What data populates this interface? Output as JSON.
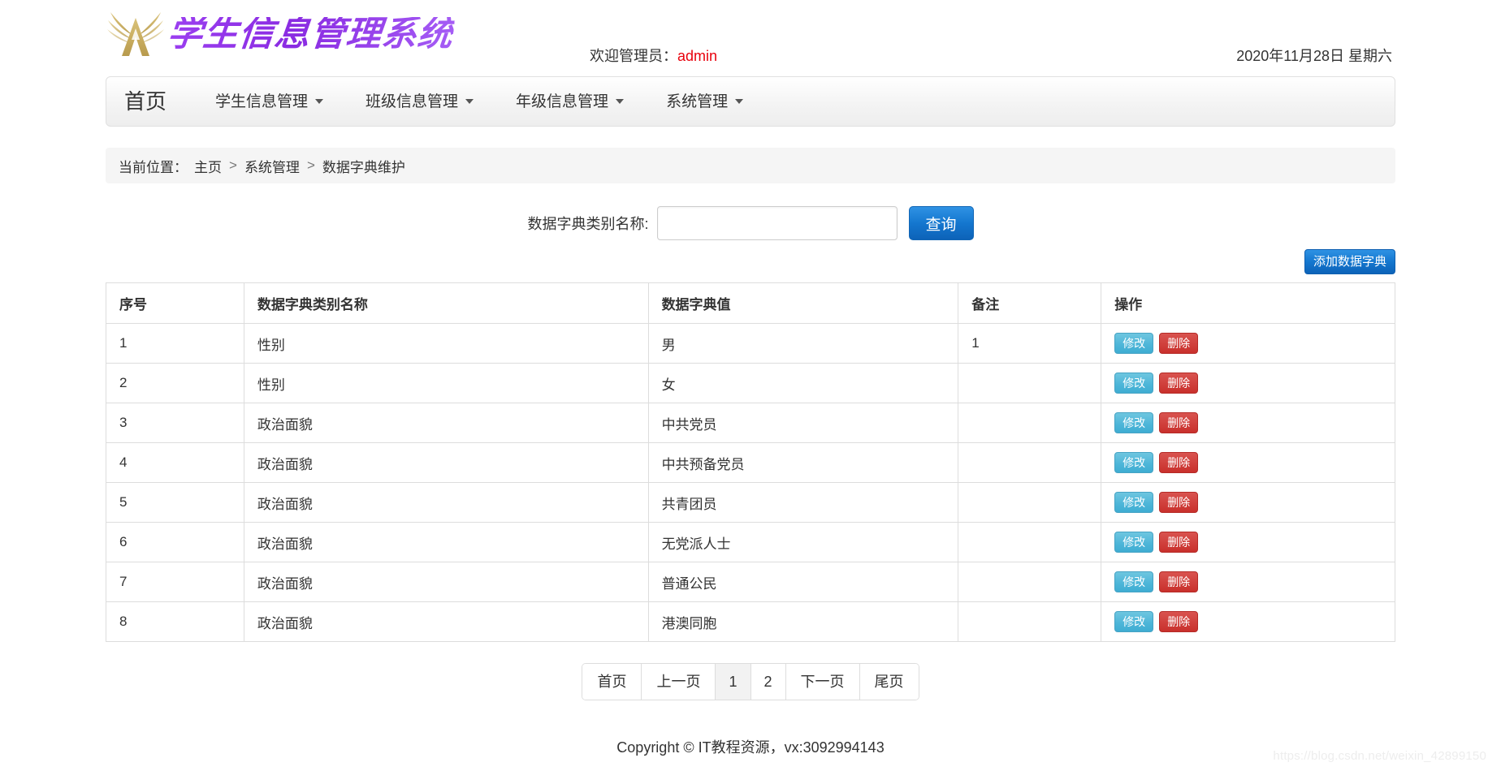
{
  "header": {
    "logo_text": "学生信息管理系统",
    "logo_icon": "winged-mountain-emblem",
    "welcome_prefix": "欢迎管理员：",
    "username": "admin",
    "date": "2020年11月28日 星期六",
    "brand_color": "#8a2be2",
    "user_color": "#e8000c"
  },
  "nav": {
    "home": "首页",
    "items": [
      {
        "label": "学生信息管理",
        "caret": "chevron-down-icon"
      },
      {
        "label": "班级信息管理",
        "caret": "chevron-down-icon"
      },
      {
        "label": "年级信息管理",
        "caret": "chevron-down-icon"
      },
      {
        "label": "系统管理",
        "caret": "chevron-down-icon"
      }
    ]
  },
  "breadcrumb": {
    "label": "当前位置：",
    "items": [
      "主页",
      "系统管理",
      "数据字典维护"
    ],
    "separator": ">"
  },
  "search": {
    "label": "数据字典类别名称:",
    "value": "",
    "placeholder": "",
    "button": "查询"
  },
  "toolbar": {
    "add_label": "添加数据字典"
  },
  "table": {
    "columns": [
      "序号",
      "数据字典类别名称",
      "数据字典值",
      "备注",
      "操作"
    ],
    "rows": [
      {
        "idx": "1",
        "name": "性别",
        "value": "男",
        "memo": "1",
        "edit": "修改",
        "del": "删除"
      },
      {
        "idx": "2",
        "name": "性别",
        "value": "女",
        "memo": "",
        "edit": "修改",
        "del": "删除"
      },
      {
        "idx": "3",
        "name": "政治面貌",
        "value": "中共党员",
        "memo": "",
        "edit": "修改",
        "del": "删除"
      },
      {
        "idx": "4",
        "name": "政治面貌",
        "value": "中共预备党员",
        "memo": "",
        "edit": "修改",
        "del": "删除"
      },
      {
        "idx": "5",
        "name": "政治面貌",
        "value": "共青团员",
        "memo": "",
        "edit": "修改",
        "del": "删除"
      },
      {
        "idx": "6",
        "name": "政治面貌",
        "value": "无党派人士",
        "memo": "",
        "edit": "修改",
        "del": "删除"
      },
      {
        "idx": "7",
        "name": "政治面貌",
        "value": "普通公民",
        "memo": "",
        "edit": "修改",
        "del": "删除"
      },
      {
        "idx": "8",
        "name": "政治面貌",
        "value": "港澳同胞",
        "memo": "",
        "edit": "修改",
        "del": "删除"
      }
    ]
  },
  "pagination": {
    "first": "首页",
    "prev": "上一页",
    "pages": [
      "1",
      "2"
    ],
    "current": "1",
    "next": "下一页",
    "last": "尾页"
  },
  "footer": {
    "copyright": "Copyright © IT教程资源，vx:3092994143"
  },
  "watermark": {
    "text": "https://blog.csdn.net/weixin_42899150"
  }
}
